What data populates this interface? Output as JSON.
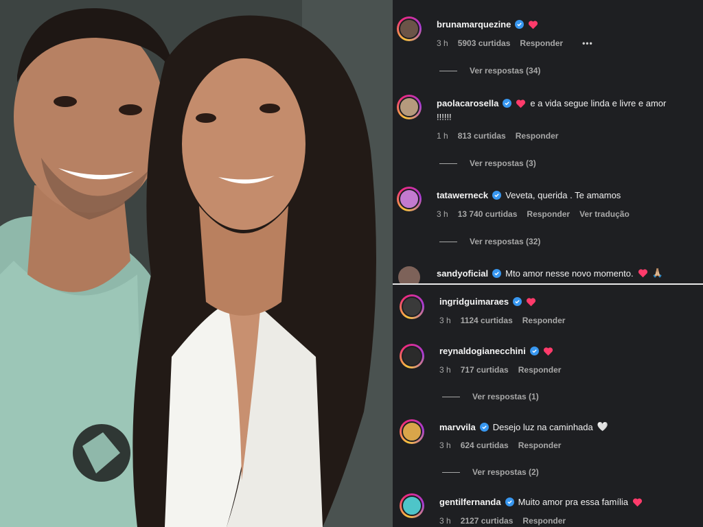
{
  "photo": {
    "alt": ""
  },
  "comments_top": [
    {
      "user": "brunamarquezine",
      "text": "",
      "hearts": 1,
      "time": "3 h",
      "likes": "5903 curtidas",
      "reply": "Responder",
      "more": "•••",
      "replies": "Ver respostas (34)"
    },
    {
      "user": "paolacarosella",
      "text": "e a vida segue linda e livre e amor",
      "text2": "!!!!!!",
      "hearts": 1,
      "time": "1 h",
      "likes": "813 curtidas",
      "reply": "Responder",
      "replies": "Ver respostas (3)"
    },
    {
      "user": "tatawerneck",
      "text": "Veveta, querida . Te amamos",
      "time": "3 h",
      "likes": "13 740 curtidas",
      "reply": "Responder",
      "translate": "Ver tradução",
      "replies": "Ver respostas (32)"
    },
    {
      "user": "sandyoficial",
      "text": "Mto amor nesse novo momento.",
      "hearts": 1,
      "emoji": "🙏🏼"
    }
  ],
  "comments_bottom": [
    {
      "user": "ingridguimaraes",
      "text": "",
      "hearts": 1,
      "time": "3 h",
      "likes": "1124 curtidas",
      "reply": "Responder"
    },
    {
      "user": "reynaldogianecchini",
      "text": "",
      "hearts": 1,
      "time": "3 h",
      "likes": "717 curtidas",
      "reply": "Responder",
      "replies": "Ver respostas (1)"
    },
    {
      "user": "marvvila",
      "text": "Desejo luz na caminhada",
      "white_heart": "🤍",
      "time": "3 h",
      "likes": "624 curtidas",
      "reply": "Responder",
      "replies": "Ver respostas (2)"
    },
    {
      "user": "gentilfernanda",
      "text": "Muito amor pra essa família",
      "hearts": 1,
      "time": "3 h",
      "likes": "2127 curtidas",
      "reply": "Responder"
    }
  ],
  "colors": {
    "heart": "#ff3b6b",
    "verified": "#3897f0",
    "panel": "#1e1f22"
  }
}
